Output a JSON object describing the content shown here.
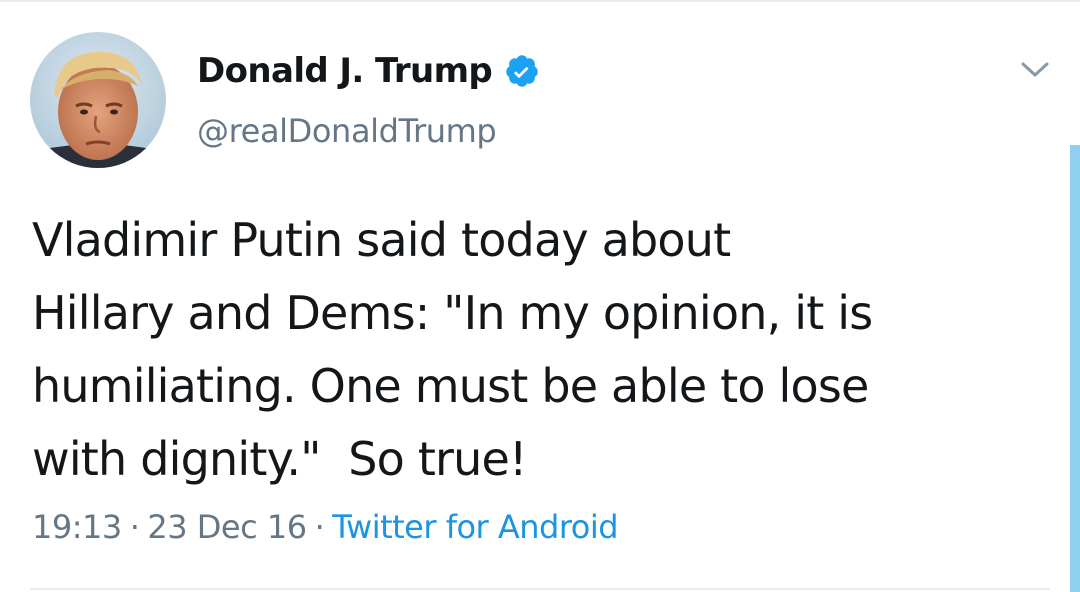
{
  "tweet": {
    "author": {
      "display_name": "Donald J. Trump",
      "handle": "@realDonaldTrump",
      "verified": true
    },
    "text": "Vladimir Putin said today about\nHillary and Dems: \"In my opinion, it is\nhumiliating. One must be able to lose\nwith dignity.\"  So true!",
    "time": "19:13",
    "separator": "·",
    "date": "23 Dec 16",
    "source": "Twitter for Android"
  },
  "icons": {
    "verified": "verified-badge-icon",
    "menu": "chevron-down-icon"
  },
  "colors": {
    "accent": "#1b95e0",
    "verified": "#1da1f2",
    "text_primary": "#14171a",
    "text_secondary": "#657786",
    "divider": "#e6ecf0",
    "scrollbar": "#8fd0f0"
  }
}
